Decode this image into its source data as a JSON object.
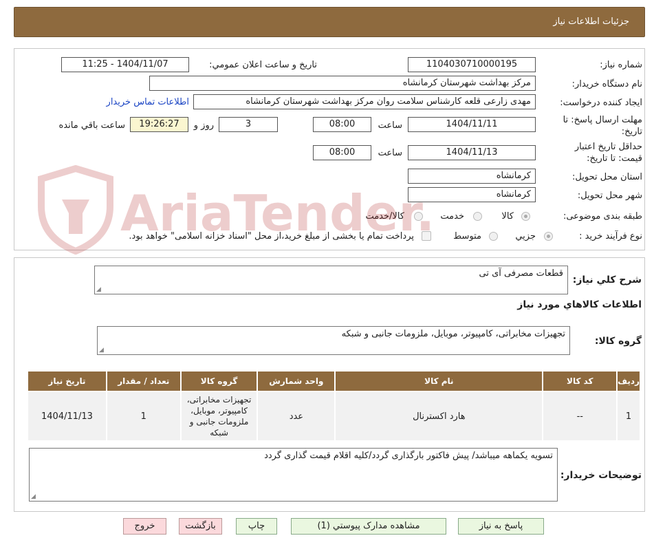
{
  "header": {
    "title": "جزئیات اطلاعات نیاز"
  },
  "form": {
    "need_number_label": "شماره نیاز:",
    "need_number": "1104030710000195",
    "announce_label": "تاریخ و ساعت اعلان عمومي:",
    "announce_value": "1404/11/07 - 11:25",
    "buyer_label": "نام دستگاه خریدار:",
    "buyer_value": "مرکز بهداشت شهرستان کرمانشاه",
    "requester_label": "ایجاد کننده درخواست:",
    "requester_value": "مهدی  زارعی قلعه کارشناس سلامت روان مرکز بهداشت شهرستان کرمانشاه",
    "contact_link": "اطلاعات تماس خریدار",
    "deadline_label_1": "مهلت ارسال پاسخ: تا",
    "deadline_label_2": "تاریخ:",
    "deadline_date": "1404/11/11",
    "time_label": "ساعت",
    "deadline_time": "08:00",
    "days_value": "3",
    "days_label": "روز و",
    "remaining_time": "19:26:27",
    "remaining_label": "ساعت باقي مانده",
    "validity_label_1": "حداقل تاریخ اعتبار",
    "validity_label_2": "قیمت: تا تاریخ:",
    "validity_date": "1404/11/13",
    "validity_time": "08:00",
    "province_label": "استان محل تحویل:",
    "province_value": "کرمانشاه",
    "city_label": "شهر محل تحویل:",
    "city_value": "کرمانشاه",
    "category_label": "طبقه بندی موضوعی:",
    "category_options": [
      "کالا",
      "خدمت",
      "کالا/خدمت"
    ],
    "process_label": "نوع فرآیند خرید :",
    "process_options": [
      "جزیي",
      "متوسط"
    ],
    "payment_note": "پرداخت تمام یا بخشی از مبلغ خرید،از محل \"اسناد خزانه اسلامی\" خواهد بود."
  },
  "summary": {
    "general_label": "شرح کلي نیاز:",
    "general_value": "قطعات مصرفی آی تی",
    "items_title": "اطلاعات کالاهاي مورد نیاز",
    "group_label": "گروه کالا:",
    "group_value": "تجهیزات مخابراتی، کامپیوتر، موبایل، ملزومات جانبی و شبکه"
  },
  "table": {
    "headers": [
      "ردیف",
      "کد کالا",
      "نام کالا",
      "واحد شمارش",
      "گروه کالا",
      "تعداد / مقدار",
      "تاریخ نیاز"
    ],
    "rows": [
      [
        "1",
        "--",
        "هارد اکسترنال",
        "عدد",
        "تجهیزات مخابراتی، کامپیوتر، موبایل، ملزومات جانبی و شبکه",
        "1",
        "1404/11/13"
      ]
    ]
  },
  "buyer_notes": {
    "label": "توضیحات خریدار:",
    "value": "تسویه یکماهه میباشد/ پیش فاکتور بارگذاری گردد/کلیه اقلام قیمت گذاری گردد"
  },
  "buttons": {
    "reply": "پاسخ به نیاز",
    "attachments": "مشاهده مدارک پیوستي (1)",
    "print": "چاپ",
    "back": "بازگشت",
    "exit": "خروج"
  },
  "watermark": {
    "text": "AriaTender.neT",
    "color": "#b22222"
  }
}
